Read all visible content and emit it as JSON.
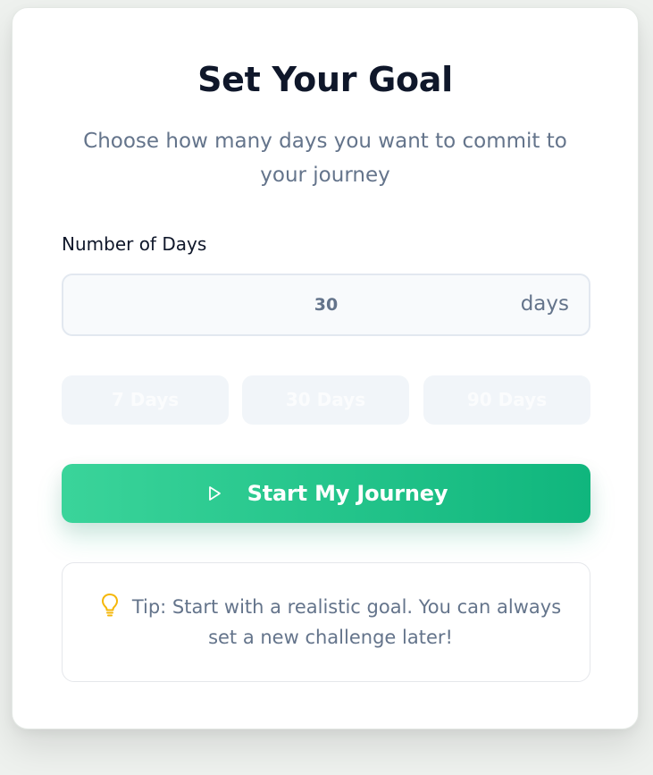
{
  "header": {
    "title": "Set Your Goal",
    "subtitle": "Choose how many days you want to commit to your journey"
  },
  "days_field": {
    "label": "Number of Days",
    "value": "30",
    "suffix": "days"
  },
  "presets": [
    {
      "label": "7 Days"
    },
    {
      "label": "30 Days"
    },
    {
      "label": "90 Days"
    }
  ],
  "start_button": {
    "label": "Start My Journey",
    "icon": "play-icon"
  },
  "tip": {
    "icon": "lightbulb-icon",
    "text": "Tip: Start with a realistic goal. You can always set a new challenge later!"
  },
  "colors": {
    "accent_start": "#3ad49a",
    "accent_end": "#10b67d",
    "tip_icon": "#f5b70a",
    "title": "#0f172a",
    "muted_text": "#64748b"
  }
}
